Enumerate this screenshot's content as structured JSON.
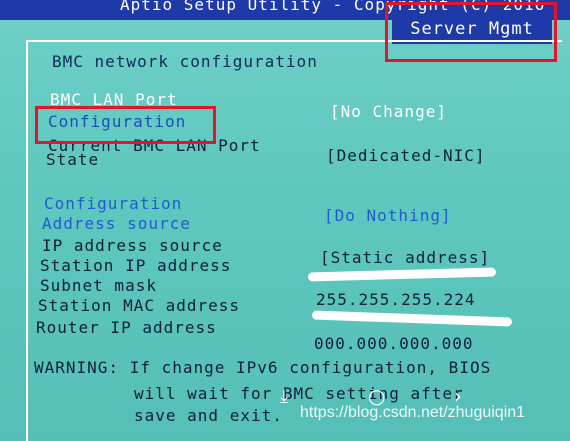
{
  "header": {
    "title": "Aptio Setup Utility - Copyright (C) 2016",
    "active_tab": "Server Mgmt"
  },
  "panel": {
    "title": "BMC network configuration"
  },
  "fields": [
    {
      "label": "BMC LAN Port",
      "value": ""
    },
    {
      "label": "Configuration",
      "value": "[No Change]"
    },
    {
      "label": "Current BMC LAN Port",
      "value": ""
    },
    {
      "label": "State",
      "value": "[Dedicated-NIC]"
    },
    {
      "label": "Configuration",
      "value": ""
    },
    {
      "label": "Address source",
      "value": "[Do Nothing]"
    },
    {
      "label": "IP address source",
      "value": "[Static address]"
    },
    {
      "label": "Station IP address",
      "value": ""
    },
    {
      "label": "Subnet mask",
      "value": "255.255.255.224"
    },
    {
      "label": "Station MAC address",
      "value": ""
    },
    {
      "label": "Router IP address",
      "value": "000.000.000.000"
    }
  ],
  "warning": {
    "line1": "WARNING: If change IPv6 configuration, BIOS",
    "line2": "will wait for BMC setting after",
    "line3": "save and exit."
  },
  "watermark": "https://blog.csdn.net/zhuguiqin1",
  "colors": {
    "highlight_box": "#e3152a",
    "header_bg": "#1e3aa8",
    "screen_bg": "#5fc8bf",
    "accent_blue": "#1f5ccf"
  },
  "icons": [
    "download-icon",
    "circle-icon",
    "chevron-right-icon"
  ]
}
